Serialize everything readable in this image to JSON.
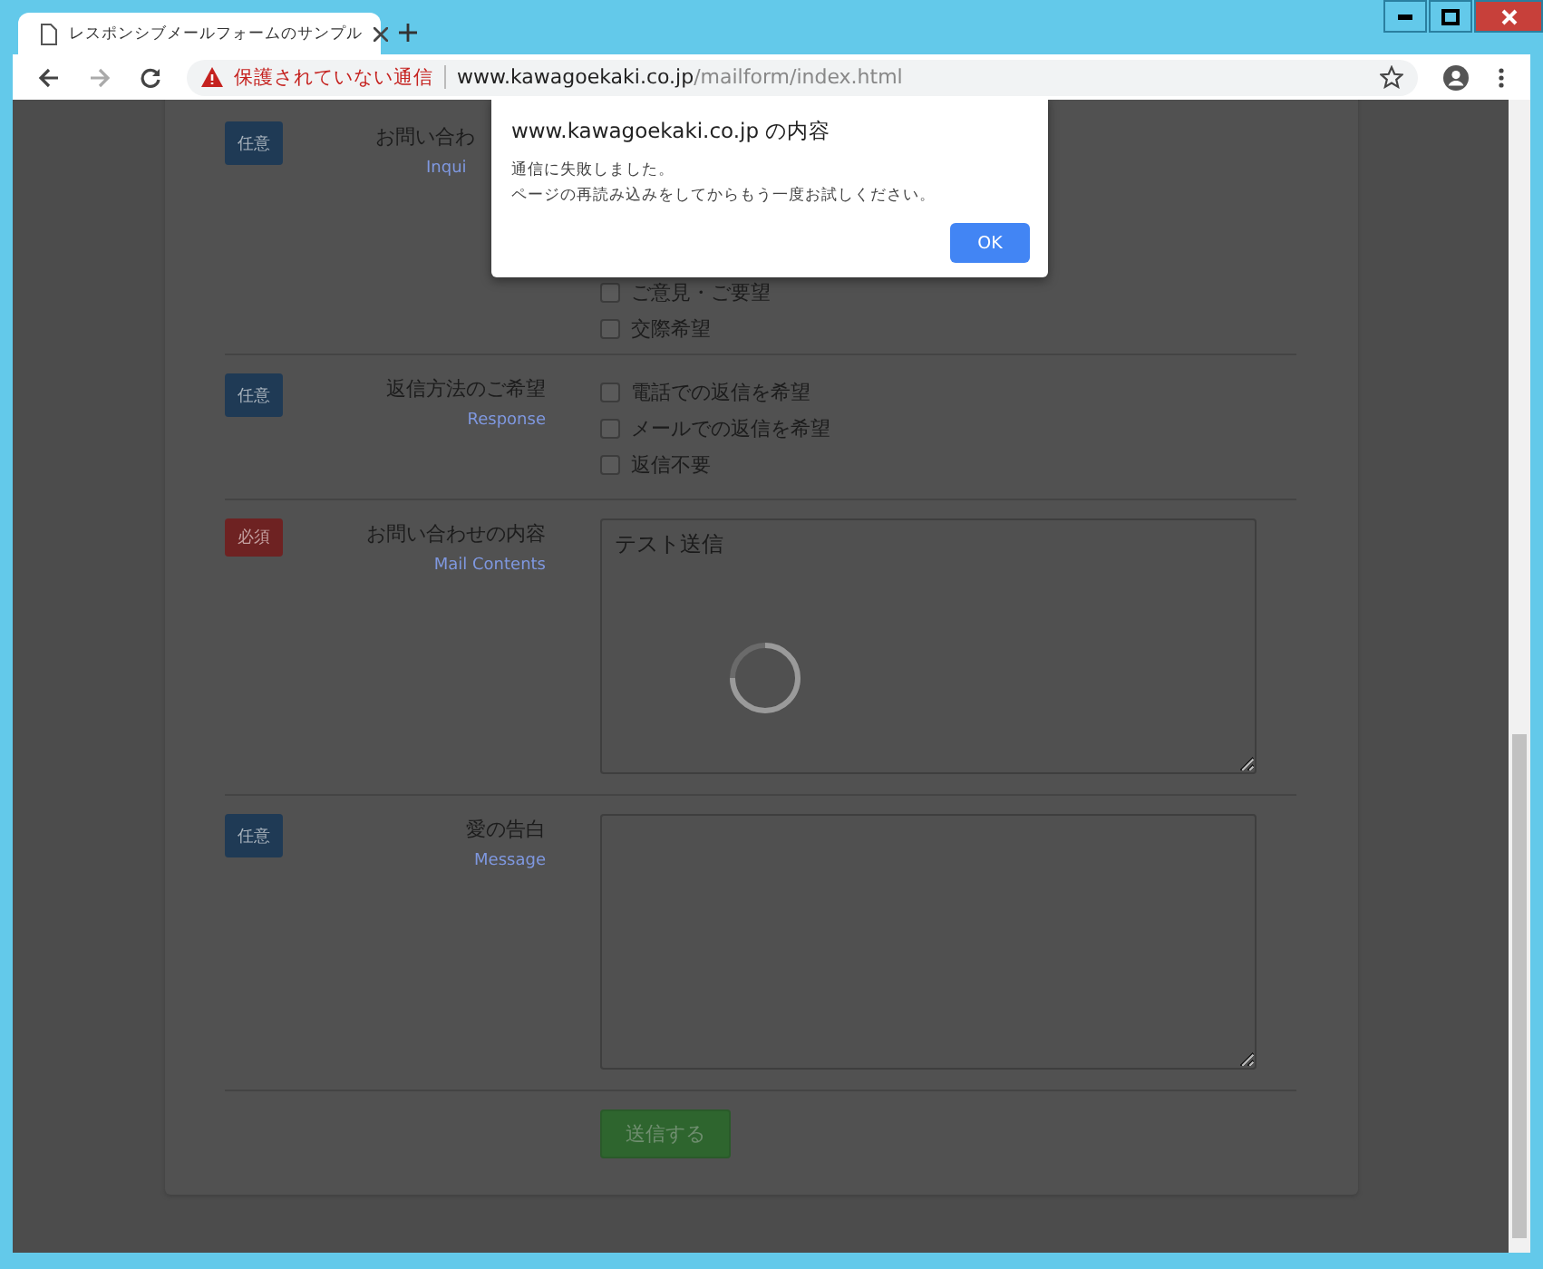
{
  "browser": {
    "tab_title": "レスポンシブメールフォームのサンプル",
    "security_label": "保護されていない通信",
    "url_host": "www.kawagoekaki.co.jp",
    "url_path": "/mailform/index.html"
  },
  "form": {
    "rows": [
      {
        "kind": "checkboxes",
        "badge": {
          "kind": "optional",
          "text": "任意"
        },
        "label": "お問い合わ",
        "sublabel": "Inqui",
        "options": [
          {
            "label": "ご意見・ご要望",
            "checked": false
          },
          {
            "label": "交際希望",
            "checked": false
          }
        ]
      },
      {
        "kind": "checkboxes",
        "badge": {
          "kind": "optional",
          "text": "任意"
        },
        "label": "返信方法のご希望",
        "sublabel": "Response",
        "options": [
          {
            "label": "電話での返信を希望",
            "checked": false
          },
          {
            "label": "メールでの返信を希望",
            "checked": false
          },
          {
            "label": "返信不要",
            "checked": false
          }
        ]
      },
      {
        "kind": "textarea",
        "badge": {
          "kind": "required",
          "text": "必須"
        },
        "label": "お問い合わせの内容",
        "sublabel": "Mail Contents",
        "value": "テスト送信",
        "loading": true
      },
      {
        "kind": "textarea",
        "badge": {
          "kind": "optional",
          "text": "任意"
        },
        "label": "愛の告白",
        "sublabel": "Message",
        "value": "",
        "loading": false
      }
    ],
    "submit": "送信する"
  },
  "dialog": {
    "title": "www.kawagoekaki.co.jp の内容",
    "lines": [
      "通信に失敗しました。",
      "ページの再読み込みをしてからもう一度お試しください。"
    ],
    "button": "OK"
  }
}
